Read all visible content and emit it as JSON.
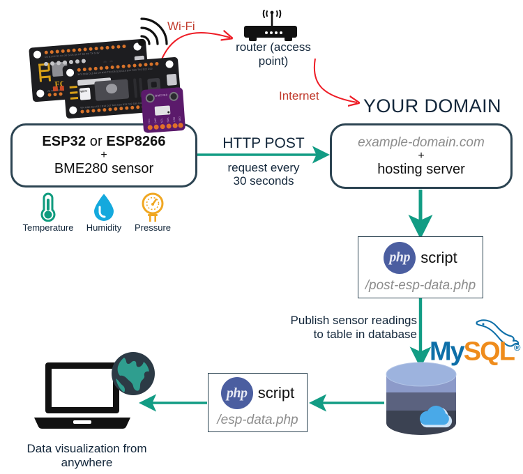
{
  "diagram": {
    "title": "ESP32/ESP8266 BME280 data to MySQL database flow",
    "accent_teal": "#129c84",
    "accent_red": "#ee1c25",
    "box_border": "#2c4452",
    "gray_italic": "#8c8c8c"
  },
  "nodes": {
    "esp_box": {
      "line1_bold_a": "ESP32",
      "line1_mid": " or ",
      "line1_bold_b": "ESP8266",
      "plus": "+",
      "line2": "BME280 sensor"
    },
    "domain_title": "YOUR DOMAIN",
    "domain_box": {
      "line1": "example-domain.com",
      "plus": "+",
      "line2": "hosting server"
    },
    "php_post": {
      "badge": "php",
      "label": "script",
      "file": "/post-esp-data.php"
    },
    "php_get": {
      "badge": "php",
      "label": "script",
      "file": "/esp-data.php"
    },
    "mysql_logo": "MySQL",
    "mysql_trademark": "®"
  },
  "labels": {
    "wifi": "Wi-Fi",
    "router": "router (access point)",
    "internet": "Internet",
    "http_post": "HTTP POST",
    "http_post_sub_line1": "request every",
    "http_post_sub_line2": "30 seconds",
    "publish_line1": "Publish sensor readings",
    "publish_line2": "to table in database",
    "viz_line1": "Data visualization from",
    "viz_line2": "anywhere"
  },
  "sensor_icons": [
    {
      "name": "thermometer-icon",
      "caption": "Temperature",
      "color": "#0f9b7e"
    },
    {
      "name": "water-drop-icon",
      "caption": "Humidity",
      "color": "#14a9dd"
    },
    {
      "name": "pressure-gauge-icon",
      "caption": "Pressure",
      "color": "#f0a722"
    }
  ],
  "icons": {
    "wifi_signal": "wifi-signal-icon",
    "router": "router-icon",
    "database": "database-cylinder-icon",
    "cloud": "cloud-icon",
    "laptop": "laptop-icon",
    "globe": "globe-icon",
    "dolphin": "mysql-dolphin-icon"
  }
}
